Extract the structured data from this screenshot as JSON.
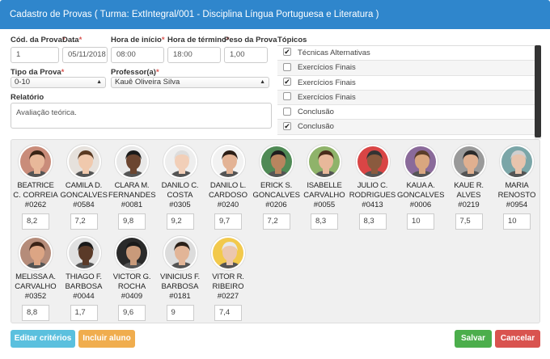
{
  "title": "Cadastro de Provas ( Turma: ExtIntegral/001 - Disciplina Língua Portuguesa e Literatura )",
  "form": {
    "cod_label": "Cód. da Prova",
    "cod_value": "1",
    "data_label": "Data",
    "data_value": "05/11/2018",
    "inicio_label": "Hora de início",
    "inicio_value": "08:00",
    "termino_label": "Hora de término",
    "termino_value": "18:00",
    "peso_label": "Peso da Prova",
    "peso_value": "1,00",
    "tipo_label": "Tipo da Prova",
    "tipo_value": "0-10",
    "professor_label": "Professor(a)",
    "professor_value": "Kauê Oliveira Silva",
    "relatorio_label": "Relatório",
    "relatorio_value": "Avaliação teórica.",
    "required_mark": "*"
  },
  "topics": {
    "label": "Tópicos",
    "items": [
      {
        "label": "Técnicas Alternativas",
        "checked": true
      },
      {
        "label": "Exercícios Finais",
        "checked": false
      },
      {
        "label": "Exercícios Finais",
        "checked": true
      },
      {
        "label": "Exercícios Finais",
        "checked": false
      },
      {
        "label": "Conclusão",
        "checked": false
      },
      {
        "label": "Conclusão",
        "checked": true
      }
    ]
  },
  "students": [
    {
      "first": "BEATRICE",
      "last": "C. CORREIA",
      "code": "#0262",
      "grade": "8,2",
      "skin": "#e8b89a",
      "hair": "#3a2416",
      "bg": "#c98c7a"
    },
    {
      "first": "CAMILA D.",
      "last": "GONCALVES",
      "code": "#0584",
      "grade": "7,2",
      "skin": "#f0c9ad",
      "hair": "#5a3a22",
      "bg": "#e6e1dc"
    },
    {
      "first": "CLARA M.",
      "last": "FERNANDES",
      "code": "#0081",
      "grade": "9,8",
      "skin": "#6b4530",
      "hair": "#1a1a1a",
      "bg": "#e9e9e9"
    },
    {
      "first": "DANILO C.",
      "last": "COSTA",
      "code": "#0305",
      "grade": "9,2",
      "skin": "#f2cfb8",
      "hair": "#dddddd",
      "bg": "#eeeeee"
    },
    {
      "first": "DANILO L.",
      "last": "CARDOSO",
      "code": "#0240",
      "grade": "9,7",
      "skin": "#e3b395",
      "hair": "#2b1e16",
      "bg": "#f2f2f2"
    },
    {
      "first": "ERICK S.",
      "last": "GONCALVES",
      "code": "#0206",
      "grade": "7,2",
      "skin": "#b8855f",
      "hair": "#1e1e1e",
      "bg": "#4f8a55"
    },
    {
      "first": "ISABELLE",
      "last": "CARVALHO",
      "code": "#0055",
      "grade": "8,3",
      "skin": "#e8b89a",
      "hair": "#4a2c1a",
      "bg": "#8fb36a"
    },
    {
      "first": "JULIO C.",
      "last": "RODRIGUES",
      "code": "#0413",
      "grade": "8,3",
      "skin": "#8a5a3e",
      "hair": "#333333",
      "bg": "#d94545"
    },
    {
      "first": "KAUA A.",
      "last": "GONCALVES",
      "code": "#0006",
      "grade": "10",
      "skin": "#d9a67f",
      "hair": "#5a3d2a",
      "bg": "#8a6a9a"
    },
    {
      "first": "KAUE R.",
      "last": "ALVES",
      "code": "#0219",
      "grade": "7,5",
      "skin": "#e0b090",
      "hair": "#2a2a2a",
      "bg": "#9a9a9a"
    },
    {
      "first": "MARIA",
      "last": "RENOSTO",
      "code": "#0954",
      "grade": "10",
      "skin": "#e7c4ad",
      "hair": "#cfcfcf",
      "bg": "#7ba6a8"
    },
    {
      "first": "MELISSA A.",
      "last": "CARVALHO",
      "code": "#0352",
      "grade": "8,8",
      "skin": "#dca584",
      "hair": "#3b2418",
      "bg": "#b58c7a"
    },
    {
      "first": "THIAGO F.",
      "last": "BARBOSA",
      "code": "#0044",
      "grade": "1,7",
      "skin": "#5a3a28",
      "hair": "#1a1a1a",
      "bg": "#e0e0e0"
    },
    {
      "first": "VICTOR G.",
      "last": "ROCHA",
      "code": "#0409",
      "grade": "9,6",
      "skin": "#c99a7a",
      "hair": "#1a1a1a",
      "bg": "#2a2a2a"
    },
    {
      "first": "VINICIUS F.",
      "last": "BARBOSA",
      "code": "#0181",
      "grade": "9",
      "skin": "#e2b597",
      "hair": "#2a2018",
      "bg": "#dcdcdc"
    },
    {
      "first": "VITOR R.",
      "last": "RIBEIRO",
      "code": "#0227",
      "grade": "7,4",
      "skin": "#ecc7ae",
      "hair": "#e8e8e8",
      "bg": "#f2c94c"
    }
  ],
  "buttons": {
    "edit": "Editar critérios",
    "add": "Incluir aluno",
    "save": "Salvar",
    "cancel": "Cancelar"
  },
  "colors": {
    "header": "#2f86cc",
    "edit": "#5bc0de",
    "add": "#f0ad4e",
    "save": "#4cae4c",
    "cancel": "#d9534f"
  }
}
